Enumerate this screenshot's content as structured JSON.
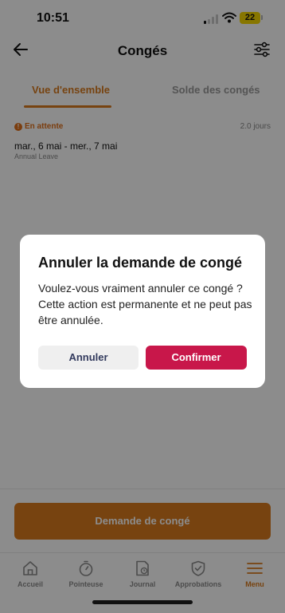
{
  "status_bar": {
    "time": "10:51",
    "battery": "22",
    "icons": [
      "cellular-signal-icon",
      "wifi-icon",
      "battery-icon"
    ]
  },
  "header": {
    "title": "Congés",
    "back_icon": "arrow-left-icon",
    "filter_icon": "sliders-icon"
  },
  "tabs": [
    {
      "label": "Vue d'ensemble",
      "active": true
    },
    {
      "label": "Solde des congés",
      "active": false
    }
  ],
  "request": {
    "status": "En attente",
    "status_icon": "alert-circle-icon",
    "duration": "2.0 jours",
    "dates": "mar., 6 mai - mer., 7 mai",
    "leave_type": "Annual Leave"
  },
  "dialog": {
    "title": "Annuler la demande de congé",
    "message": "Voulez-vous vraiment annuler ce congé ? Cette action est permanente et ne peut pas être annulée.",
    "cancel_label": "Annuler",
    "confirm_label": "Confirmer"
  },
  "actions": {
    "request_leave_label": "Demande de congé"
  },
  "nav": [
    {
      "label": "Accueil",
      "icon": "home-icon",
      "active": false
    },
    {
      "label": "Pointeuse",
      "icon": "stopwatch-icon",
      "active": false
    },
    {
      "label": "Journal",
      "icon": "journal-icon",
      "active": false
    },
    {
      "label": "Approbations",
      "icon": "shield-check-icon",
      "active": false
    },
    {
      "label": "Menu",
      "icon": "menu-icon",
      "active": true
    }
  ],
  "colors": {
    "accent": "#d97b1e",
    "confirm": "#c8174a",
    "pending": "#e0701a",
    "battery": "#f6d700"
  }
}
